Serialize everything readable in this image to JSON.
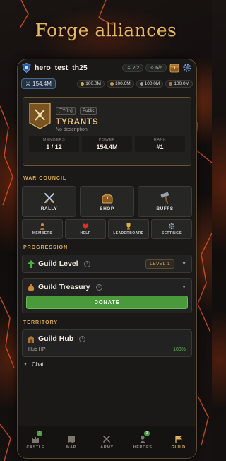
{
  "headline": "Forge alliances",
  "status": {
    "player_name": "hero_test_th25",
    "troops": "2/2",
    "queue": "6/6"
  },
  "resources": {
    "power": "154.4M",
    "items": [
      {
        "icon": "gold-coin-icon",
        "value": "100.0M",
        "color": "#d8a93a"
      },
      {
        "icon": "food-icon",
        "value": "100.0M",
        "color": "#c79a4a"
      },
      {
        "icon": "stone-icon",
        "value": "100.0M",
        "color": "#9aa0a6"
      },
      {
        "icon": "wood-icon",
        "value": "100.0M",
        "color": "#b07a3c"
      }
    ]
  },
  "guild": {
    "tag": "[TYRN]",
    "visibility": "Public",
    "name": "TYRANTS",
    "description": "No description.",
    "stats": [
      {
        "label": "MEMBERS",
        "value": "1 / 12"
      },
      {
        "label": "POWER",
        "value": "154.4M"
      },
      {
        "label": "RANK",
        "value": "#1"
      }
    ]
  },
  "war_council": {
    "title": "WAR COUNCIL",
    "big_buttons": [
      {
        "label": "RALLY",
        "icon": "crossed-swords-icon"
      },
      {
        "label": "SHOP",
        "icon": "chest-icon"
      },
      {
        "label": "BUFFS",
        "icon": "hammer-icon"
      }
    ],
    "small_buttons": [
      {
        "label": "MEMBERS",
        "icon": "members-icon"
      },
      {
        "label": "HELP",
        "icon": "heart-icon"
      },
      {
        "label": "LEADERBOARD",
        "icon": "trophy-icon"
      },
      {
        "label": "SETTINGS",
        "icon": "gear-icon"
      }
    ]
  },
  "progression": {
    "title": "PROGRESSION",
    "guild_level": {
      "label": "Guild Level",
      "badge": "LEVEL 1"
    },
    "treasury": {
      "label": "Guild Treasury",
      "button": "DONATE"
    }
  },
  "territory": {
    "title": "TERRITORY",
    "hub": {
      "label": "Guild Hub",
      "hp_label": "Hub HP",
      "hp_value": "100%"
    }
  },
  "chat": {
    "label": "Chat"
  },
  "tabs": [
    {
      "label": "CASTLE",
      "icon": "castle-icon",
      "badge": "1",
      "active": false
    },
    {
      "label": "MAP",
      "icon": "map-icon",
      "badge": "",
      "active": false
    },
    {
      "label": "ARMY",
      "icon": "crossed-swords-icon",
      "badge": "",
      "active": false
    },
    {
      "label": "HEROES",
      "icon": "hero-icon",
      "badge": "3",
      "active": false
    },
    {
      "label": "GUILD",
      "icon": "flag-icon",
      "badge": "",
      "active": true
    }
  ],
  "colors": {
    "accent_gold": "#e3b864",
    "donate_green": "#4a9a3c",
    "power_blue": "#263244",
    "lava": "#d2461a"
  }
}
